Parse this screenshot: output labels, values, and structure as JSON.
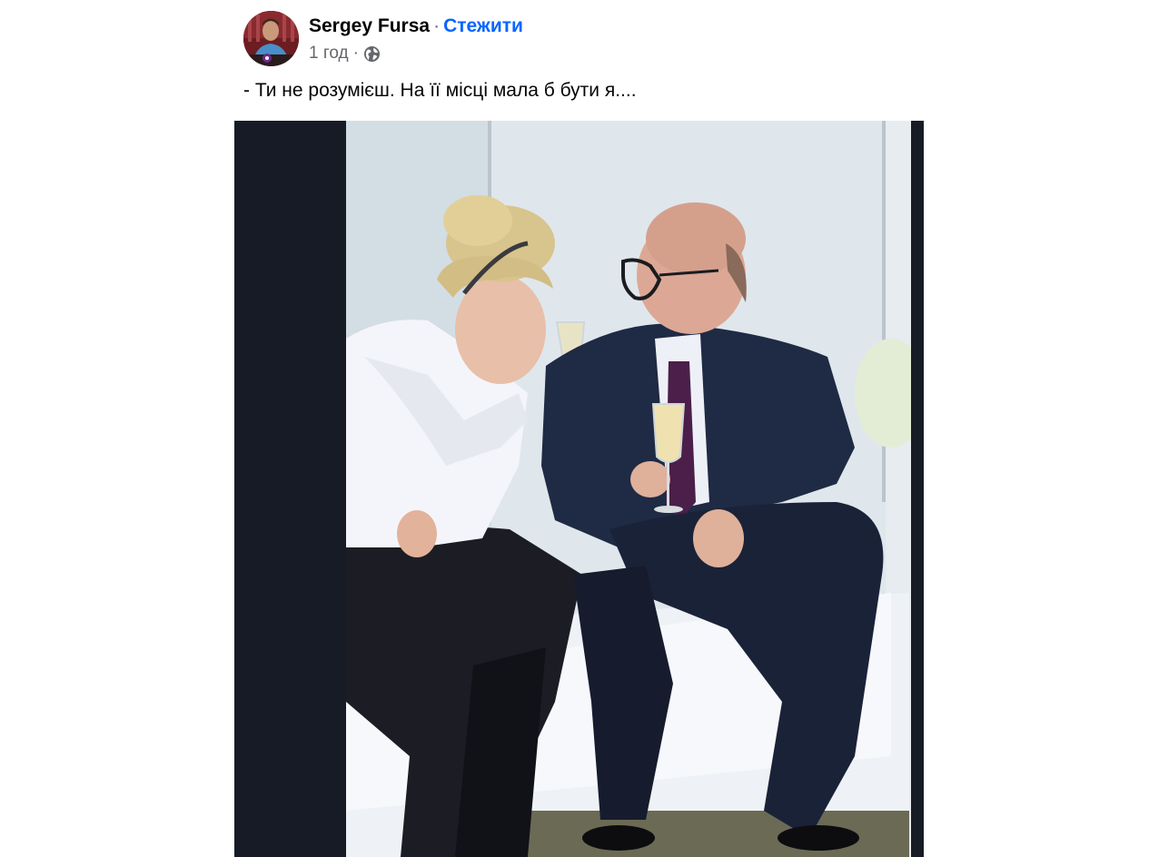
{
  "post": {
    "author_name": "Sergey Fursa",
    "separator": "·",
    "follow_label": "Стежити",
    "time": "1 год",
    "meta_separator": "·",
    "audience_icon": "globe-icon",
    "text": "- Ти не розумієш. На її місці мала б бути я....",
    "photo": {
      "description_icon": "photo"
    }
  },
  "colors": {
    "link_blue": "#0866ff",
    "secondary_text": "#65676b",
    "primary_text": "#050505",
    "media_background": "#161b26"
  }
}
